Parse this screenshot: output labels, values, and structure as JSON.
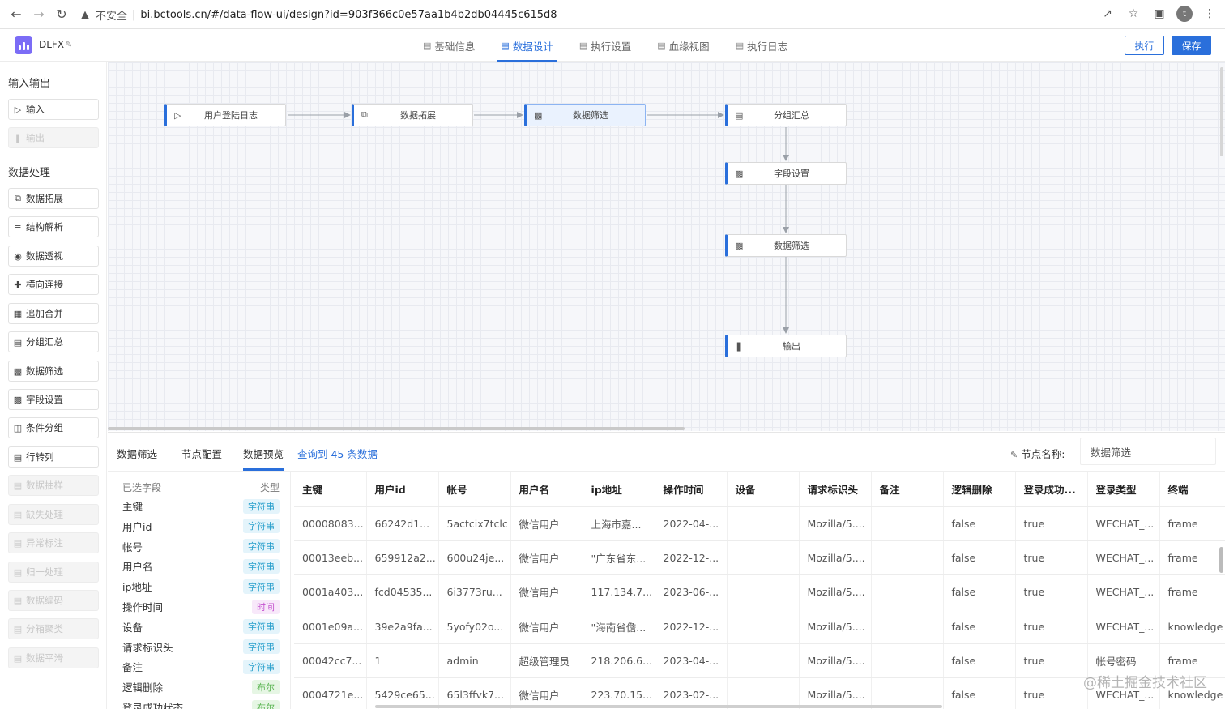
{
  "browser": {
    "insecure_label": "不安全",
    "separator": "|",
    "url": "bi.bctools.cn/#/data-flow-ui/design?id=903f366c0e57aa1b4b2db04445c615d8",
    "profile_initial": "t"
  },
  "app": {
    "name": "DLFX",
    "tabs": [
      {
        "label": "基础信息"
      },
      {
        "label": "数据设计"
      },
      {
        "label": "执行设置"
      },
      {
        "label": "血缘视图"
      },
      {
        "label": "执行日志"
      }
    ],
    "run_label": "执行",
    "save_label": "保存",
    "colors": {
      "accent": "#2a6fdb",
      "logo": "#7b6cf6"
    }
  },
  "palette": {
    "io_title": "输入输出",
    "io_items": [
      {
        "label": "输入",
        "icon": "play-circle-icon",
        "disabled": false
      },
      {
        "label": "输出",
        "icon": "pause-circle-icon",
        "disabled": true
      }
    ],
    "proc_title": "数据处理",
    "proc_items": [
      {
        "label": "数据拓展",
        "icon": "copy-icon",
        "disabled": false
      },
      {
        "label": "结构解析",
        "icon": "sliders-icon",
        "disabled": false
      },
      {
        "label": "数据透视",
        "icon": "eye-icon",
        "disabled": false
      },
      {
        "label": "横向连接",
        "icon": "move-icon",
        "disabled": false
      },
      {
        "label": "追加合并",
        "icon": "calendar-icon",
        "disabled": false
      },
      {
        "label": "分组汇总",
        "icon": "document-icon",
        "disabled": false
      },
      {
        "label": "数据筛选",
        "icon": "filter-doc-icon",
        "disabled": false
      },
      {
        "label": "字段设置",
        "icon": "edit-doc-icon",
        "disabled": false
      },
      {
        "label": "条件分组",
        "icon": "columns-icon",
        "disabled": false
      },
      {
        "label": "行转列",
        "icon": "archive-icon",
        "disabled": false
      },
      {
        "label": "数据抽样",
        "icon": "archive-icon",
        "disabled": true
      },
      {
        "label": "缺失处理",
        "icon": "archive-icon",
        "disabled": true
      },
      {
        "label": "异常标注",
        "icon": "archive-icon",
        "disabled": true
      },
      {
        "label": "归一处理",
        "icon": "archive-icon",
        "disabled": true
      },
      {
        "label": "数据编码",
        "icon": "archive-icon",
        "disabled": true
      },
      {
        "label": "分箱聚类",
        "icon": "archive-icon",
        "disabled": true
      },
      {
        "label": "数据平滑",
        "icon": "archive-icon",
        "disabled": true
      }
    ]
  },
  "flow": {
    "nodes": [
      {
        "label": "用户登陆日志",
        "icon": "play-circle-icon"
      },
      {
        "label": "数据拓展",
        "icon": "copy-icon"
      },
      {
        "label": "数据筛选",
        "icon": "filter-doc-icon",
        "selected": true
      },
      {
        "label": "分组汇总",
        "icon": "document-icon"
      },
      {
        "label": "字段设置",
        "icon": "edit-doc-icon"
      },
      {
        "label": "数据筛选",
        "icon": "filter-doc-icon"
      },
      {
        "label": "输出",
        "icon": "pause-circle-icon"
      }
    ]
  },
  "bottom": {
    "tabs": [
      {
        "label": "数据筛选"
      },
      {
        "label": "节点配置"
      },
      {
        "label": "数据预览"
      }
    ],
    "query_info": "查询到 45 条数据",
    "node_name_label": "节点名称:",
    "node_name_value": "数据筛选",
    "fields_header": {
      "name": "已选字段",
      "type": "类型"
    },
    "fields": [
      {
        "name": "主键",
        "type": "字符串",
        "kind": "str"
      },
      {
        "name": "用户id",
        "type": "字符串",
        "kind": "str"
      },
      {
        "name": "帐号",
        "type": "字符串",
        "kind": "str"
      },
      {
        "name": "用户名",
        "type": "字符串",
        "kind": "str"
      },
      {
        "name": "ip地址",
        "type": "字符串",
        "kind": "str"
      },
      {
        "name": "操作时间",
        "type": "时间",
        "kind": "time"
      },
      {
        "name": "设备",
        "type": "字符串",
        "kind": "str"
      },
      {
        "name": "请求标识头",
        "type": "字符串",
        "kind": "str"
      },
      {
        "name": "备注",
        "type": "字符串",
        "kind": "str"
      },
      {
        "name": "逻辑删除",
        "type": "布尔",
        "kind": "bool"
      },
      {
        "name": "登录成功状态",
        "type": "布尔",
        "kind": "bool"
      }
    ],
    "table": {
      "columns": [
        "主键",
        "用户id",
        "帐号",
        "用户名",
        "ip地址",
        "操作时间",
        "设备",
        "请求标识头",
        "备注",
        "逻辑删除",
        "登录成功...",
        "登录类型",
        "终端"
      ],
      "rows": [
        [
          "00008083...",
          "66242d1...",
          "5actcix7tclc",
          "微信用户",
          "上海市嘉...",
          "2022-04-...",
          "",
          "Mozilla/5....",
          "",
          "false",
          "true",
          "WECHAT_...",
          "frame"
        ],
        [
          "00013eeb...",
          "659912a2...",
          "600u24je...",
          "微信用户",
          "\"广东省东...",
          "2022-12-...",
          "",
          "Mozilla/5....",
          "",
          "false",
          "true",
          "WECHAT_...",
          "frame"
        ],
        [
          "0001a403...",
          "fcd04535...",
          "6i3773ru...",
          "微信用户",
          "117.134.7...",
          "2023-06-...",
          "",
          "Mozilla/5....",
          "",
          "false",
          "true",
          "WECHAT_...",
          "frame"
        ],
        [
          "0001e09a...",
          "39e2a9fa...",
          "5yofy02o...",
          "微信用户",
          "\"海南省儋...",
          "2022-12-...",
          "",
          "Mozilla/5....",
          "",
          "false",
          "true",
          "WECHAT_...",
          "knowledge"
        ],
        [
          "00042cc7...",
          "1",
          "admin",
          "超级管理员",
          "218.206.6...",
          "2023-04-...",
          "",
          "Mozilla/5....",
          "",
          "false",
          "true",
          "帐号密码",
          "frame"
        ],
        [
          "0004721e...",
          "5429ce65...",
          "65l3ffvk7...",
          "微信用户",
          "223.70.15...",
          "2023-02-...",
          "",
          "Mozilla/5....",
          "",
          "false",
          "true",
          "WECHAT_...",
          "knowledge"
        ]
      ]
    }
  },
  "watermark": "@稀土掘金技术社区"
}
